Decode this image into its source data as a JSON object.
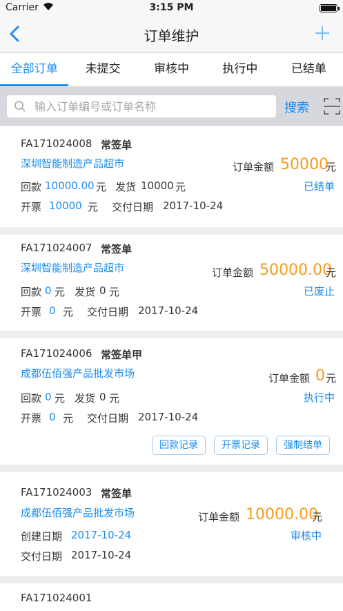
{
  "status_bar": {
    "carrier": "Carrier",
    "time": "3:15 PM"
  },
  "nav": {
    "title": "订单维护"
  },
  "tabs": [
    {
      "label": "全部订单",
      "active": true
    },
    {
      "label": "未提交",
      "active": false
    },
    {
      "label": "审核中",
      "active": false
    },
    {
      "label": "执行中",
      "active": false
    },
    {
      "label": "已结单",
      "active": false
    }
  ],
  "search": {
    "placeholder": "输入订单编号或订单名称",
    "button_label": "搜索"
  },
  "labels": {
    "amount": "订单金额",
    "yuan": "元",
    "payment": "回款",
    "shipment": "发货",
    "invoice": "开票",
    "delivery_date": "交付日期",
    "created_date": "创建日期"
  },
  "orders": [
    {
      "number": "FA171024008",
      "type": "常签单",
      "customer": "深圳智能制造产品超市",
      "amount": "50000",
      "status": "已结单",
      "payment": "10000.00",
      "shipment": "10000",
      "invoice": "10000",
      "delivery_date": "2017-10-24"
    },
    {
      "number": "FA171024007",
      "type": "常签单",
      "customer": "深圳智能制造产品超市",
      "amount": "50000.00",
      "status": "已废止",
      "payment": "0",
      "shipment": "0",
      "invoice": "0",
      "delivery_date": "2017-10-24"
    },
    {
      "number": "FA171024006",
      "type": "常签单甲",
      "customer": "成都伍佰强产品批发市场",
      "amount": "0",
      "status": "执行中",
      "payment": "0",
      "shipment": "0",
      "invoice": "0",
      "delivery_date": "2017-10-24",
      "actions": [
        "回款记录",
        "开票记录",
        "强制结单"
      ]
    },
    {
      "number": "FA171024003",
      "type": "常签单",
      "customer": "成都伍佰强产品批发市场",
      "amount": "10000.00",
      "status": "审核中",
      "created_date": "2017-10-24",
      "delivery_date": "2017-10-24"
    },
    {
      "number": "FA171024001"
    }
  ],
  "colors": {
    "accent": "#1a8cf0",
    "amount": "#f89a1c"
  }
}
